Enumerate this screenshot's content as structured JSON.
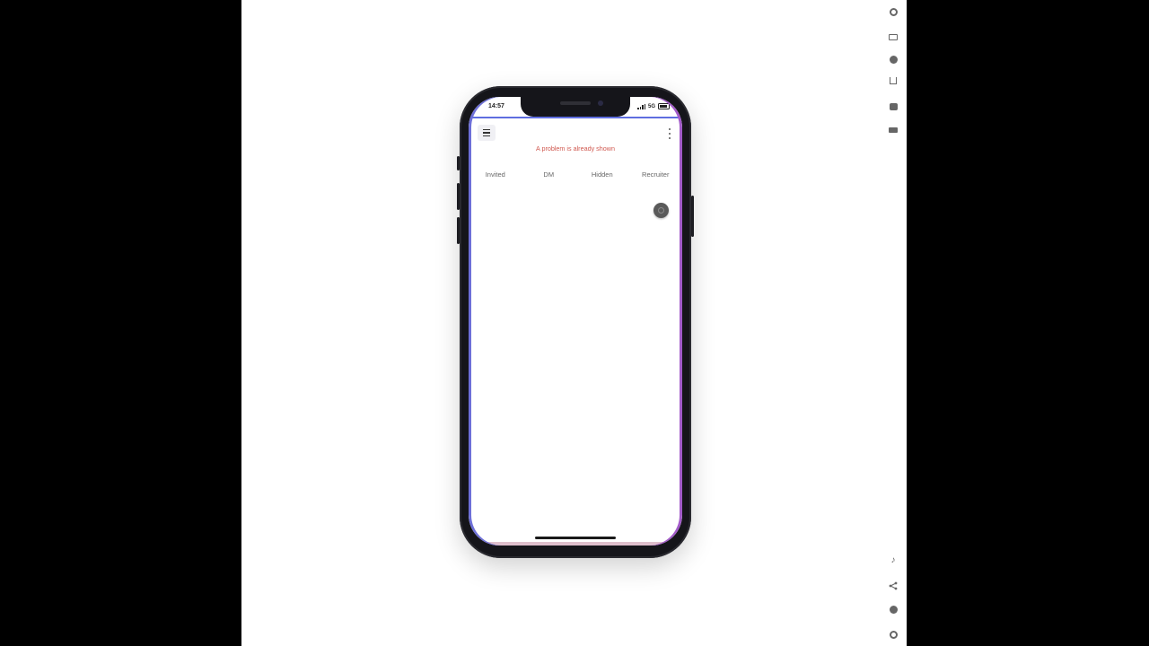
{
  "status_bar": {
    "time": "14:57",
    "network": "5G"
  },
  "app": {
    "notice": "A problem is already shown",
    "tabs": [
      "Invited",
      "DM",
      "Hidden",
      "Recruiter"
    ]
  },
  "emulator_rail": {
    "top_icons": [
      "gear-icon",
      "rotate-icon",
      "record-icon",
      "home-icon",
      "camera-icon",
      "video-icon"
    ],
    "bottom_icons": [
      "music-icon",
      "share-icon",
      "help-icon",
      "settings-icon"
    ]
  },
  "colors": {
    "accent": "#5f6ee0",
    "notice": "#d0584f",
    "edge_left": "#6d6fd8",
    "edge_right": "#a25ac9"
  }
}
